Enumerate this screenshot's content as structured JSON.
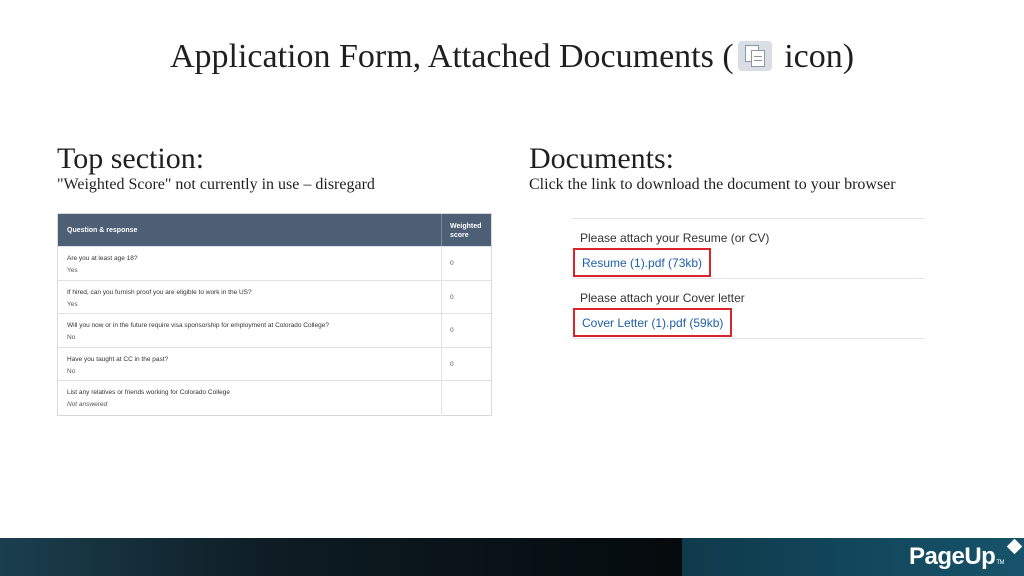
{
  "title": {
    "before": "Application Form, Attached Documents  (",
    "after": " icon)"
  },
  "icons": {
    "title_icon": "documents-icon",
    "logo_mark": "diamond-icon"
  },
  "top_section": {
    "heading": "Top section:",
    "subtitle": "\"Weighted Score\" not currently in use – disregard",
    "table": {
      "headers": {
        "question": "Question & response",
        "weighted_line1": "Weighted",
        "weighted_line2": "score"
      },
      "rows": [
        {
          "question": "Are you at least age 18?",
          "answer": "Yes",
          "score": "0"
        },
        {
          "question": "If hired, can you furnish proof you are eligible to work in the US?",
          "answer": "Yes",
          "score": "0"
        },
        {
          "question": "Will you now or in the future require visa sponsorship for employment at Colorado College?",
          "answer": "No",
          "score": "0"
        },
        {
          "question": "Have you taught at CC in the past?",
          "answer": "No",
          "score": "0"
        },
        {
          "question": "List any relatives or friends working for Colorado College",
          "answer": "Not answered",
          "score": ""
        }
      ]
    }
  },
  "documents": {
    "heading": "Documents:",
    "subtitle": "Click the link to download the document to your browser",
    "items": [
      {
        "label": "Please attach your Resume (or CV)",
        "link": "Resume (1).pdf (73kb)"
      },
      {
        "label": "Please attach your Cover letter",
        "link": "Cover Letter (1).pdf (59kb)"
      }
    ]
  },
  "footer": {
    "logo": "PageUp",
    "logo_tm": "TM"
  },
  "colors": {
    "highlight_box": "#d9232d",
    "link": "#1f5fa8",
    "table_header": "#4d5f74"
  }
}
